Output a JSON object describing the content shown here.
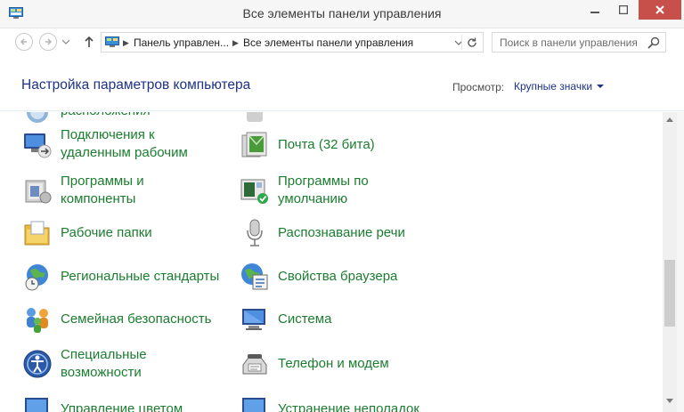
{
  "window": {
    "title": "Все элементы панели управления"
  },
  "address": {
    "crumbs": [
      "Панель управлен...",
      "Все элементы панели управления"
    ]
  },
  "search": {
    "placeholder": "Поиск в панели управления"
  },
  "header": {
    "title": "Настройка параметров компьютера",
    "view_label": "Просмотр:",
    "view_value": "Крупные значки"
  },
  "items": {
    "left": [
      {
        "lines": [
          "расположения"
        ],
        "icon": "location-icon"
      },
      {
        "lines": [
          "Подключения к",
          "удаленным рабочим"
        ],
        "icon": "remote-desktop-icon"
      },
      {
        "lines": [
          "Программы и",
          "компоненты"
        ],
        "icon": "programs-icon"
      },
      {
        "lines": [
          "Рабочие папки"
        ],
        "icon": "work-folders-icon"
      },
      {
        "lines": [
          "Региональные стандарты"
        ],
        "icon": "region-icon"
      },
      {
        "lines": [
          "Семейная безопасность"
        ],
        "icon": "family-safety-icon"
      },
      {
        "lines": [
          "Специальные",
          "возможности"
        ],
        "icon": "ease-of-access-icon"
      },
      {
        "lines": [
          "Управление цветом"
        ],
        "icon": "color-management-icon"
      }
    ],
    "right": [
      {
        "lines": [
          ""
        ],
        "icon": "partial-icon"
      },
      {
        "lines": [
          "Почта (32 бита)"
        ],
        "icon": "mail-icon"
      },
      {
        "lines": [
          "Программы по",
          "умолчанию"
        ],
        "icon": "default-programs-icon"
      },
      {
        "lines": [
          "Распознавание речи"
        ],
        "icon": "microphone-icon"
      },
      {
        "lines": [
          "Свойства браузера"
        ],
        "icon": "internet-options-icon"
      },
      {
        "lines": [
          "Система"
        ],
        "icon": "system-icon"
      },
      {
        "lines": [
          "Телефон и модем"
        ],
        "icon": "phone-modem-icon"
      },
      {
        "lines": [
          "Устранение неполадок"
        ],
        "icon": "troubleshooting-icon"
      }
    ]
  },
  "colors": {
    "link_green": "#1b7d2f",
    "title_blue": "#1e3287",
    "close_red": "#c7504b"
  }
}
